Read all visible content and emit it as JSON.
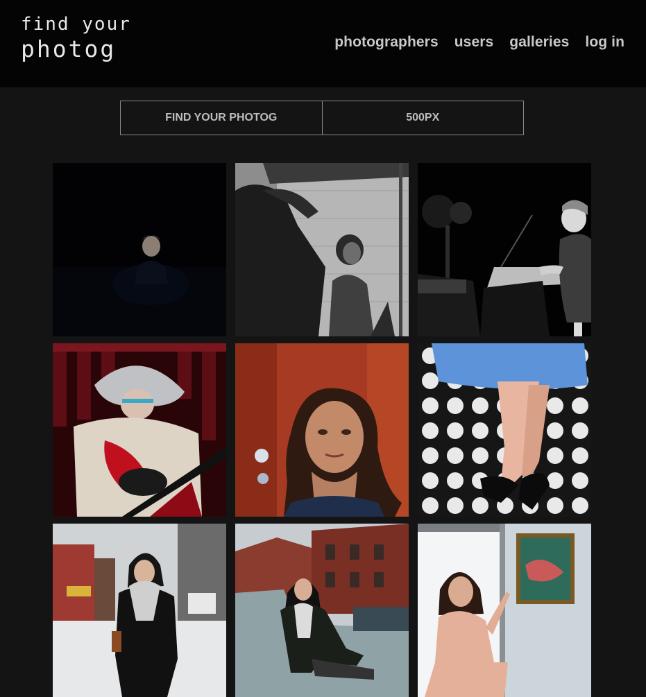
{
  "brand": {
    "line1": "find your",
    "line2": "photog"
  },
  "nav": [
    {
      "label": "photographers"
    },
    {
      "label": "users"
    },
    {
      "label": "galleries"
    },
    {
      "label": "log in"
    }
  ],
  "tabs": [
    {
      "label": "FIND YOUR PHOTOG"
    },
    {
      "label": "500PX"
    }
  ],
  "photos": [
    {
      "subject": "portrait-man-dark"
    },
    {
      "subject": "singer-brick-wall"
    },
    {
      "subject": "singer-microphone"
    },
    {
      "subject": "guitarist-red-curtain"
    },
    {
      "subject": "portrait-woman-red"
    },
    {
      "subject": "legs-polka-dot"
    },
    {
      "subject": "woman-street-snow"
    },
    {
      "subject": "woman-car-street"
    },
    {
      "subject": "woman-window"
    }
  ],
  "colors": {
    "header_bg": "#040404",
    "page_bg": "#141414",
    "nav_text": "#c9c9c9"
  }
}
